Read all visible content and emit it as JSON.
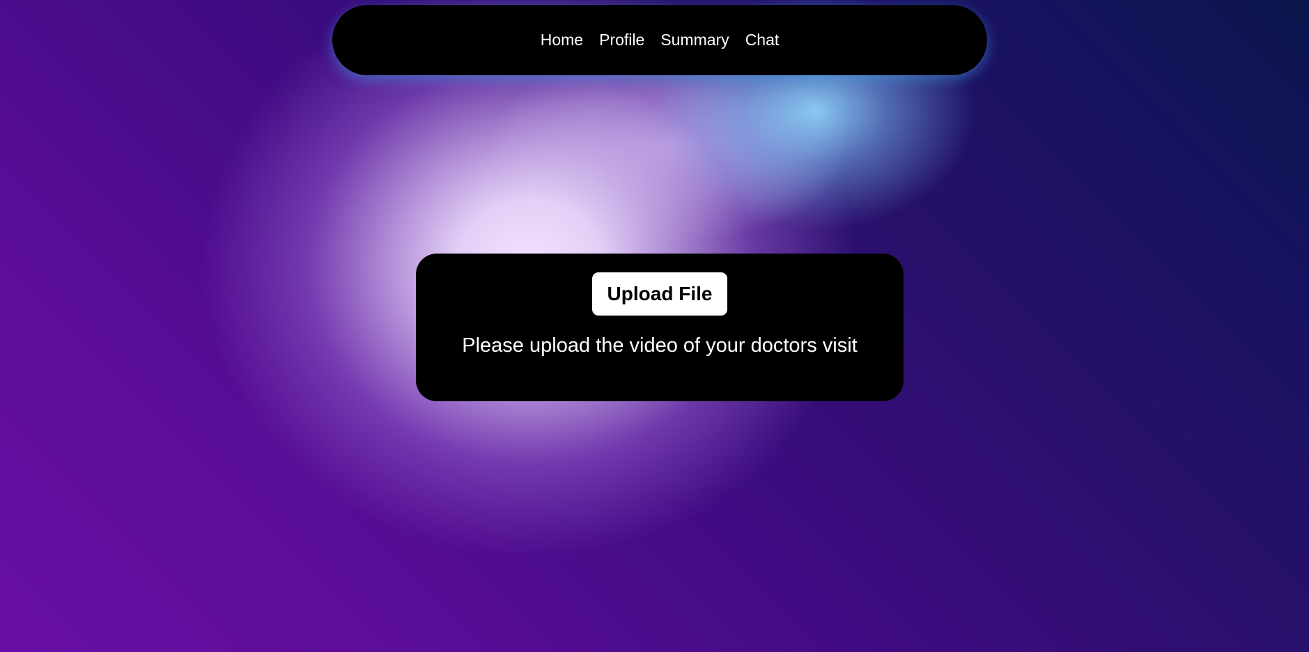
{
  "nav": {
    "items": [
      {
        "label": "Home"
      },
      {
        "label": "Profile"
      },
      {
        "label": "Summary"
      },
      {
        "label": "Chat"
      }
    ]
  },
  "upload": {
    "button_label": "Upload File",
    "hint": "Please upload the video of your doctors visit"
  },
  "colors": {
    "nav_background": "#000000",
    "card_background": "#000000",
    "button_background": "#ffffff",
    "text_light": "#ffffff",
    "background_purple": "#5a0d98",
    "background_navy": "#0a154a",
    "glow_light": "#ecdcfb",
    "glow_cyan": "#8fd0f5"
  }
}
